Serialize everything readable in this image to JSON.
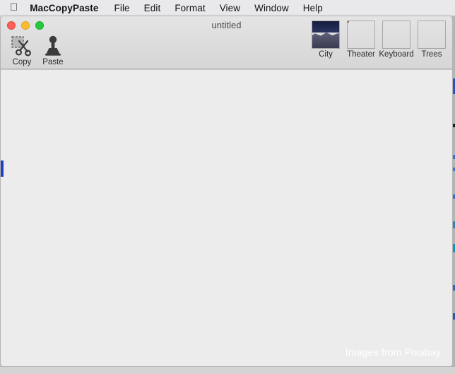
{
  "menubar": {
    "apple_glyph": "apple-logo",
    "items": [
      {
        "label": "MacCopyPaste",
        "bold": true
      },
      {
        "label": "File"
      },
      {
        "label": "Edit"
      },
      {
        "label": "Format"
      },
      {
        "label": "View"
      },
      {
        "label": "Window"
      },
      {
        "label": "Help"
      }
    ]
  },
  "window": {
    "title": "untitled",
    "traffic_lights": {
      "close": "close-button",
      "minimize": "minimize-button",
      "zoom": "zoom-button"
    },
    "colors": {
      "close": "#ff5f57",
      "minimize": "#febc2e",
      "zoom": "#28c840",
      "toolbar_bg": "#dcdcdc",
      "content_bg": "#ececec",
      "marker_blue": "#2140c0"
    }
  },
  "toolbar": {
    "left_buttons": [
      {
        "label": "Copy",
        "icon": "scissors-icon"
      },
      {
        "label": "Paste",
        "icon": "stamp-icon"
      }
    ],
    "image_buttons": [
      {
        "label": "City",
        "icon": "city-thumbnail"
      },
      {
        "label": "Theater",
        "icon": "theater-thumbnail"
      },
      {
        "label": "Keyboard",
        "icon": "keyboard-thumbnail"
      },
      {
        "label": "Trees",
        "icon": "trees-thumbnail"
      }
    ]
  },
  "content": {
    "watermark": "Images from Pixabay"
  }
}
